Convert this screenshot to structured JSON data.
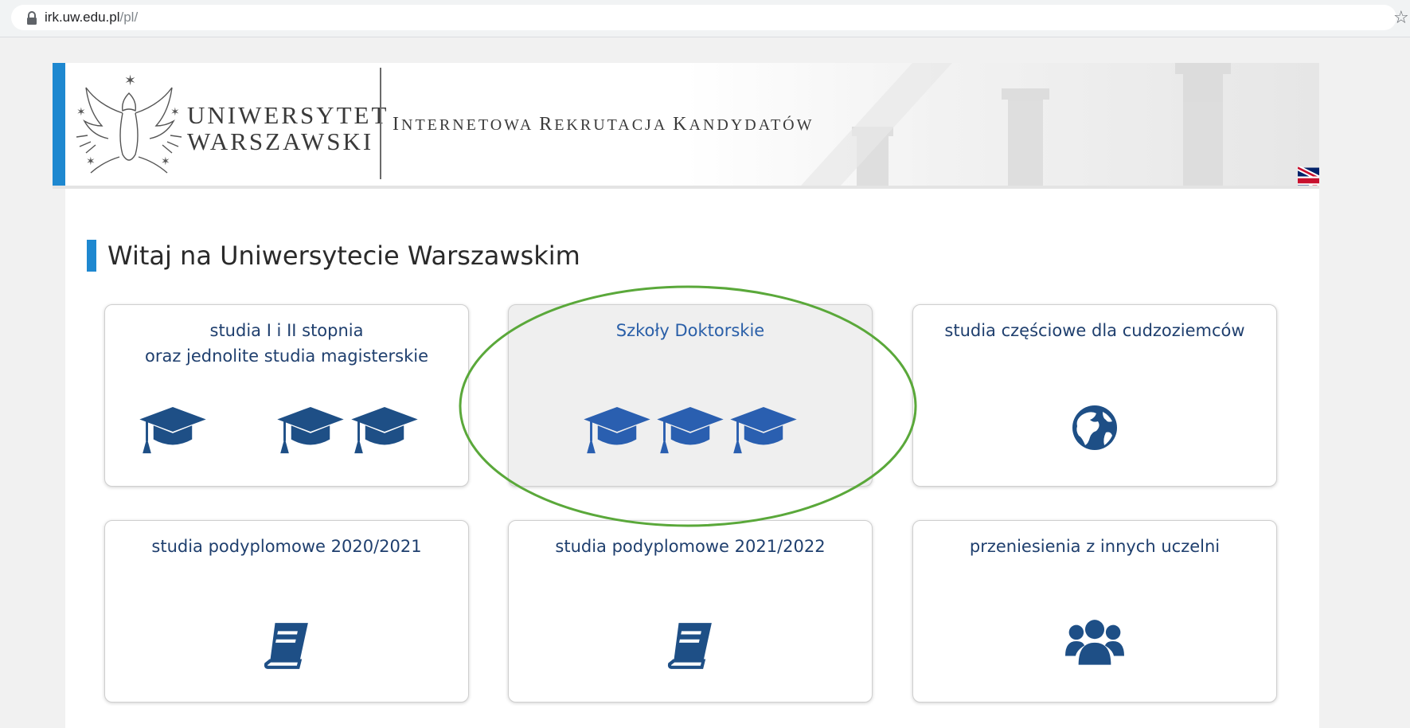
{
  "browser": {
    "url_host": "irk.uw.edu.pl",
    "url_path": "/pl/"
  },
  "header": {
    "university_line1": "UNIWERSYTET",
    "university_line2": "WARSZAWSKI",
    "system_name_parts": [
      "I",
      "NTERNETOWA ",
      "R",
      "EKRUTACJA ",
      "K",
      "ANDYDATÓW"
    ]
  },
  "main": {
    "title": "Witaj na Uniwersytecie Warszawskim",
    "tiles": [
      {
        "label_line1": "studia I i II stopnia",
        "label_line2": "oraz jednolite studia magisterskie",
        "icon": "graduation-cap-icon"
      },
      {
        "label_line1": "Szkoły Doktorskie",
        "label_line2": "",
        "icon": "graduation-cap-icon"
      },
      {
        "label_line1": "studia częściowe dla cudzoziemców",
        "label_line2": "",
        "icon": "globe-icon"
      },
      {
        "label_line1": "studia podyplomowe 2020/2021",
        "label_line2": "",
        "icon": "book-icon"
      },
      {
        "label_line1": "studia podyplomowe 2021/2022",
        "label_line2": "",
        "icon": "book-icon"
      },
      {
        "label_line1": "przeniesienia z innych uczelni",
        "label_line2": "",
        "icon": "users-icon"
      }
    ]
  },
  "colors": {
    "accent_blue": "#1e88d0",
    "tile_text": "#1f3f6e",
    "icon_dark": "#1e4f86",
    "icon_hover": "#2a5fb0",
    "annotation_green": "#5aa83a"
  }
}
